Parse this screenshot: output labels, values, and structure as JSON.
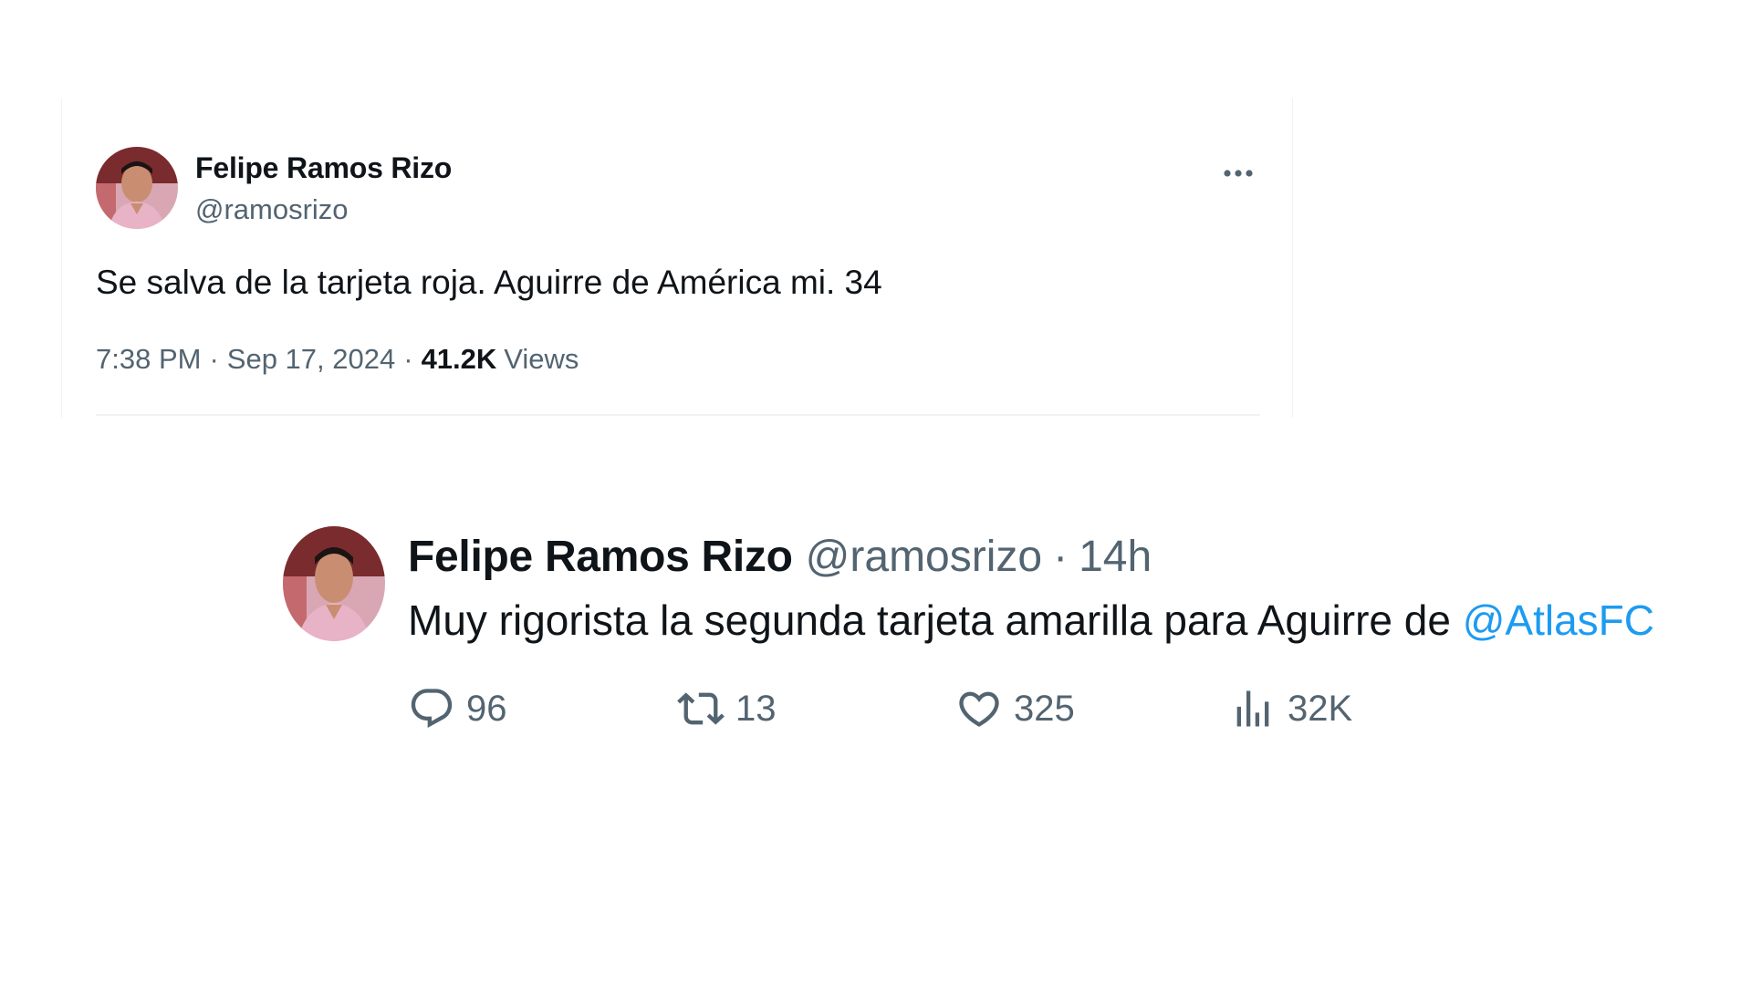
{
  "tweet1": {
    "author_name": "Felipe Ramos Rizo",
    "author_handle": "@ramosrizo",
    "more_icon": "more-horizontal-icon",
    "text": "Se salva de la tarjeta roja. Aguirre de América mi. 34",
    "time": "7:38 PM",
    "separator": "·",
    "date": "Sep 17, 2024",
    "views_count": "41.2K",
    "views_label": "Views"
  },
  "tweet2": {
    "author_name": "Felipe Ramos Rizo",
    "author_handle": "@ramosrizo",
    "separator": "·",
    "time_ago": "14h",
    "text_before_mention": "Muy rigorista  la segunda tarjeta amarilla para Aguirre de ",
    "mention": "@AtlasFC",
    "actions": {
      "reply": {
        "icon": "reply-icon",
        "count": "96"
      },
      "retweet": {
        "icon": "retweet-icon",
        "count": "13"
      },
      "like": {
        "icon": "heart-icon",
        "count": "325"
      },
      "views": {
        "icon": "analytics-icon",
        "count": "32K"
      }
    }
  },
  "colors": {
    "text_primary": "#0f1419",
    "text_secondary": "#536471",
    "mention_blue": "#1d9bf0",
    "divider": "#eff3f4"
  }
}
